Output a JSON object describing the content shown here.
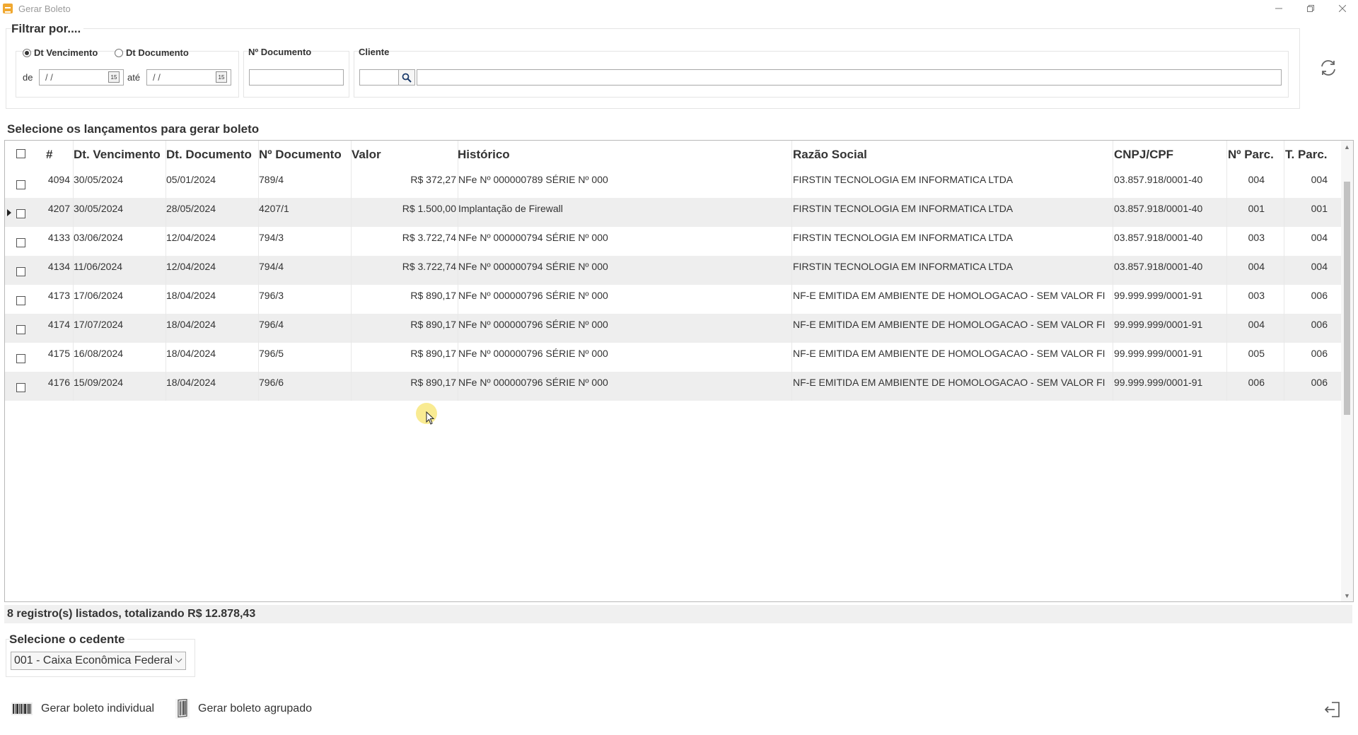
{
  "window": {
    "title": "Gerar Boleto"
  },
  "filter": {
    "title": "Filtrar por....",
    "date_options": [
      "Dt Vencimento",
      "Dt Documento"
    ],
    "selected_option": "Dt Vencimento",
    "from_label": "de",
    "to_label": "até",
    "from_value": " /  /",
    "to_value": " /  /",
    "doc_number_label": "Nº Documento",
    "doc_number_value": "",
    "client_label": "Cliente",
    "client_code_value": "",
    "client_name_value": ""
  },
  "grid": {
    "title": "Selecione os lançamentos para gerar boleto",
    "columns": [
      "#",
      "Dt. Vencimento",
      "Dt. Documento",
      "Nº Documento",
      "Valor",
      "Histórico",
      "Razão Social",
      "CNPJ/CPF",
      "Nº Parc.",
      "T. Parc."
    ],
    "rows": [
      [
        "4094",
        "30/05/2024",
        "05/01/2024",
        "789/4",
        "R$ 372,27",
        "NFe Nº 000000789 SÉRIE Nº 000",
        "FIRSTIN TECNOLOGIA EM INFORMATICA LTDA",
        "03.857.918/0001-40",
        "004",
        "004"
      ],
      [
        "4207",
        "30/05/2024",
        "28/05/2024",
        "4207/1",
        "R$ 1.500,00",
        "Implantação de Firewall",
        "FIRSTIN TECNOLOGIA EM INFORMATICA LTDA",
        "03.857.918/0001-40",
        "001",
        "001"
      ],
      [
        "4133",
        "03/06/2024",
        "12/04/2024",
        "794/3",
        "R$ 3.722,74",
        "NFe Nº 000000794 SÉRIE Nº 000",
        "FIRSTIN TECNOLOGIA EM INFORMATICA LTDA",
        "03.857.918/0001-40",
        "003",
        "004"
      ],
      [
        "4134",
        "11/06/2024",
        "12/04/2024",
        "794/4",
        "R$ 3.722,74",
        "NFe Nº 000000794 SÉRIE Nº 000",
        "FIRSTIN TECNOLOGIA EM INFORMATICA LTDA",
        "03.857.918/0001-40",
        "004",
        "004"
      ],
      [
        "4173",
        "17/06/2024",
        "18/04/2024",
        "796/3",
        "R$ 890,17",
        "NFe Nº 000000796 SÉRIE Nº 000",
        "NF-E EMITIDA EM AMBIENTE DE HOMOLOGACAO - SEM VALOR FI",
        "99.999.999/0001-91",
        "003",
        "006"
      ],
      [
        "4174",
        "17/07/2024",
        "18/04/2024",
        "796/4",
        "R$ 890,17",
        "NFe Nº 000000796 SÉRIE Nº 000",
        "NF-E EMITIDA EM AMBIENTE DE HOMOLOGACAO - SEM VALOR FI",
        "99.999.999/0001-91",
        "004",
        "006"
      ],
      [
        "4175",
        "16/08/2024",
        "18/04/2024",
        "796/5",
        "R$ 890,17",
        "NFe Nº 000000796 SÉRIE Nº 000",
        "NF-E EMITIDA EM AMBIENTE DE HOMOLOGACAO - SEM VALOR FI",
        "99.999.999/0001-91",
        "005",
        "006"
      ],
      [
        "4176",
        "15/09/2024",
        "18/04/2024",
        "796/6",
        "R$ 890,17",
        "NFe Nº 000000796 SÉRIE Nº 000",
        "NF-E EMITIDA EM AMBIENTE DE HOMOLOGACAO - SEM VALOR FI",
        "99.999.999/0001-91",
        "006",
        "006"
      ]
    ],
    "current_row": 1
  },
  "summary": {
    "text": "8 registro(s) listados, totalizando R$ 12.878,43"
  },
  "cedente": {
    "title": "Selecione o cedente",
    "selected": "001 - Caixa Econômica Federal"
  },
  "actions": {
    "individual": "Gerar boleto individual",
    "grouped": "Gerar boleto agrupado"
  },
  "icons": {
    "refresh": "refresh-icon",
    "search": "search-icon",
    "exit": "exit-icon",
    "calendar": "calendar-icon",
    "barcode": "barcode-icon"
  }
}
